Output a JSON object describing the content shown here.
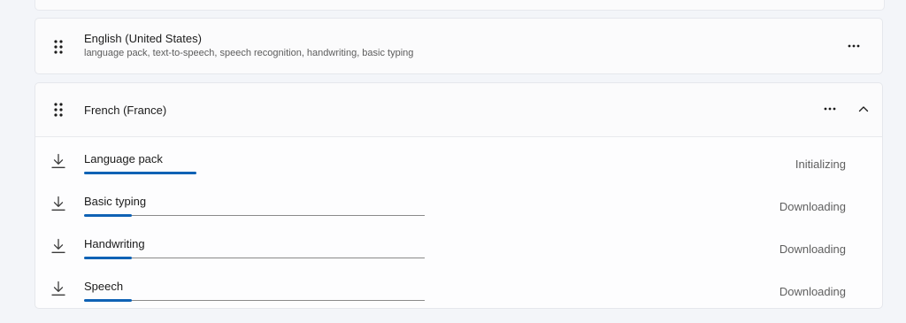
{
  "languages": [
    {
      "name": "English (United States)",
      "features": "language pack, text-to-speech, speech recognition, handwriting, basic typing",
      "more_icon": "more-horizontal-icon",
      "handle_icon": "drag-handle-icon"
    },
    {
      "name": "French (France)",
      "more_icon": "more-horizontal-icon",
      "handle_icon": "drag-handle-icon",
      "expand_icon": "chevron-up-icon",
      "expanded": true,
      "downloads": [
        {
          "label": "Language pack",
          "status": "Initializing",
          "progress": 0.33,
          "track_visible": false,
          "icon": "download-icon"
        },
        {
          "label": "Basic typing",
          "status": "Downloading",
          "progress": 0.14,
          "track_visible": true,
          "icon": "download-icon"
        },
        {
          "label": "Handwriting",
          "status": "Downloading",
          "progress": 0.14,
          "track_visible": true,
          "icon": "download-icon"
        },
        {
          "label": "Speech",
          "status": "Downloading",
          "progress": 0.14,
          "track_visible": true,
          "icon": "download-icon"
        }
      ]
    }
  ],
  "colors": {
    "accent": "#0f62b5",
    "page_bg": "#f3f5f9",
    "card_bg": "#fbfbfc"
  }
}
